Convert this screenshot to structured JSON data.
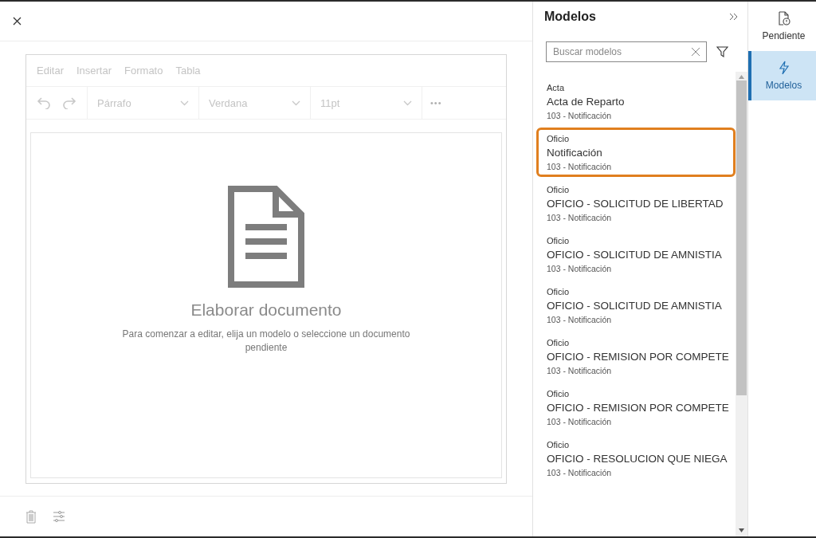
{
  "editor": {
    "menu": [
      "Editar",
      "Insertar",
      "Formato",
      "Tabla"
    ],
    "toolbar": {
      "disabled": true,
      "selects": [
        "Párrafo",
        "Verdana",
        "11pt"
      ],
      "more": "•••"
    },
    "empty_state": {
      "title": "Elaborar documento",
      "message": "Para comenzar a editar, elija un modelo o seleccione un documento pendiente"
    }
  },
  "models_panel": {
    "title": "Modelos",
    "search": {
      "placeholder": "Buscar modelos"
    },
    "items": [
      {
        "category": "Acta",
        "title": "Acta de Reparto",
        "subtitle": "103 - Notificación",
        "selected": false
      },
      {
        "category": "Oficio",
        "title": "Notificación",
        "subtitle": "103 - Notificación",
        "selected": true
      },
      {
        "category": "Oficio",
        "title": "OFICIO - SOLICITUD DE LIBERTAD",
        "subtitle": "103 - Notificación",
        "selected": false
      },
      {
        "category": "Oficio",
        "title": "OFICIO - SOLICITUD DE AMNISTIA",
        "subtitle": "103 - Notificación",
        "selected": false
      },
      {
        "category": "Oficio",
        "title": "OFICIO - SOLICITUD DE AMNISTIA",
        "subtitle": "103 - Notificación",
        "selected": false
      },
      {
        "category": "Oficio",
        "title": "OFICIO - REMISION POR COMPETE",
        "subtitle": "103 - Notificación",
        "selected": false
      },
      {
        "category": "Oficio",
        "title": "OFICIO - REMISION POR COMPETE",
        "subtitle": "103 - Notificación",
        "selected": false
      },
      {
        "category": "Oficio",
        "title": "OFICIO - RESOLUCION QUE NIEGA",
        "subtitle": "103 - Notificación",
        "selected": false
      }
    ]
  },
  "nav": [
    {
      "kind": "pending",
      "label": "Pendiente",
      "selected": false
    },
    {
      "kind": "models",
      "label": "Modelos",
      "selected": true
    }
  ]
}
